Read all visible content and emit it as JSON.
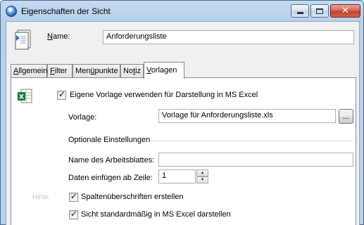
{
  "window": {
    "title": "Eigenschaften der Sicht"
  },
  "header": {
    "name_label": "Name:",
    "name_value": "Anforderungsliste"
  },
  "tabs": [
    {
      "label": "Allgemein",
      "active": false
    },
    {
      "label": "Filter",
      "active": false
    },
    {
      "label": "Menüpunkte",
      "active": false
    },
    {
      "label": "Notiz",
      "active": false
    },
    {
      "label": "Vorlagen",
      "active": true
    }
  ],
  "vorlagen": {
    "use_template_label": "Eigene Vorlage verwenden für Darstellung in MS Excel",
    "use_template_checked": true,
    "template_label": "Vorlage:",
    "template_value": "Vorlage für Anforderungsliste.xls",
    "browse_label": "...",
    "optional_section_label": "Optionale Einstellungen",
    "sheet_name_label": "Name des Arbeitsblattes:",
    "sheet_name_value": "",
    "insert_row_label": "Daten einfügen ab Zeile:",
    "insert_row_value": "1",
    "watermark_label": "Hinw.",
    "column_headers_label": "Spaltenüberschriften erstellen",
    "column_headers_checked": true,
    "show_default_label": "Sicht standardmäßig in MS Excel darstellen",
    "show_default_checked": true
  },
  "colors": {
    "title_bar": "#b9d1ea",
    "close_button": "#c4412c",
    "excel_green": "#1d7a3a"
  }
}
